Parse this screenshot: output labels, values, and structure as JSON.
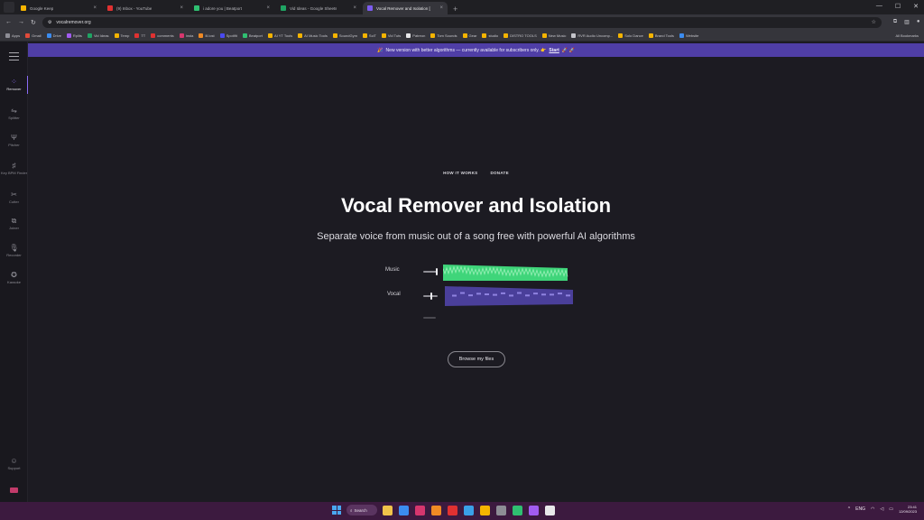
{
  "browser": {
    "tabs": [
      {
        "title": "Google Keep",
        "color": "#f5b400",
        "active": false
      },
      {
        "title": "(9) Inbox - YouTube",
        "color": "#e03131",
        "active": false
      },
      {
        "title": "i adore you | Beatport",
        "color": "#2fbf71",
        "active": false
      },
      {
        "title": "Vid Ideas - Google Sheets",
        "color": "#1fa463",
        "active": false
      },
      {
        "title": "Vocal Remover and Isolation [",
        "color": "#7c5cf0",
        "active": true
      }
    ],
    "new_tab": "+",
    "url": "vocalremover.org",
    "bookmarks": [
      {
        "label": "Apps",
        "color": "#8d8d95"
      },
      {
        "label": "Gmail",
        "color": "#e04a3a"
      },
      {
        "label": "Drive",
        "color": "#3b8cf0"
      },
      {
        "label": "Rplits",
        "color": "#a25cf0"
      },
      {
        "label": "Vid Ideas",
        "color": "#1fa463"
      },
      {
        "label": "Temp",
        "color": "#f5b400"
      },
      {
        "label": "TT",
        "color": "#e03131"
      },
      {
        "label": "comments",
        "color": "#e03131"
      },
      {
        "label": "Insta",
        "color": "#d6366e"
      },
      {
        "label": "Ill.lost",
        "color": "#f08a24"
      },
      {
        "label": "Spotifit",
        "color": "#4a4af0"
      },
      {
        "label": "Beatport",
        "color": "#2fbf71"
      },
      {
        "label": "AI YT Tools",
        "color": "#f5b400"
      },
      {
        "label": "AI Music Tools",
        "color": "#f5b400"
      },
      {
        "label": "SoundGym",
        "color": "#f5b400"
      },
      {
        "label": "SciT",
        "color": "#f5b400"
      },
      {
        "label": "Vid Tuts",
        "color": "#f5b400"
      },
      {
        "label": "Patreon",
        "color": "#e8e8ea"
      },
      {
        "label": "Tom Sounds",
        "color": "#f5b400"
      },
      {
        "label": "Gear",
        "color": "#f5b400"
      },
      {
        "label": "studio",
        "color": "#f5b400"
      },
      {
        "label": "DISTRO TOOLS",
        "color": "#f5b400"
      },
      {
        "label": "New Music",
        "color": "#f5b400"
      },
      {
        "label": "RVR Audio Uncomp...",
        "color": "#c4c4ca"
      },
      {
        "label": "Solo Dance",
        "color": "#f5b400"
      },
      {
        "label": "Brand Tools",
        "color": "#f5b400"
      },
      {
        "label": "Website",
        "color": "#3b8cf0"
      }
    ],
    "all_bookmarks": "All Bookmarks"
  },
  "sidebar": {
    "items": [
      {
        "label": "Remover",
        "icon": "remover-icon",
        "glyph": "⁘",
        "active": true
      },
      {
        "label": "Splitter",
        "icon": "splitter-icon",
        "glyph": "⇋",
        "active": false
      },
      {
        "label": "Pitcher",
        "icon": "tuning-fork-icon",
        "glyph": "Ψ",
        "active": false
      },
      {
        "label": "Key BPM Finder",
        "icon": "key-bpm-icon",
        "glyph": "♯",
        "active": false
      },
      {
        "label": "Cutter",
        "icon": "scissors-icon",
        "glyph": "✂",
        "active": false
      },
      {
        "label": "Joiner",
        "icon": "joiner-icon",
        "glyph": "⧉",
        "active": false
      },
      {
        "label": "Recorder",
        "icon": "microphone-icon",
        "glyph": "🎙",
        "active": false
      },
      {
        "label": "Karaoke",
        "icon": "karaoke-icon",
        "glyph": "✪",
        "active": false
      }
    ],
    "support": {
      "label": "Support",
      "glyph": "☺"
    }
  },
  "banner": {
    "emoji": "🎉",
    "text": "New version with better algorithms — currently available for subscribers only. 👉",
    "link": "Start",
    "trail": "🚀 🚀"
  },
  "page": {
    "nav": [
      "HOW IT WORKS",
      "DONATE"
    ],
    "title": "Vocal Remover and Isolation",
    "subtitle": "Separate voice from music out of a song free with powerful AI algorithms",
    "mixer": {
      "music_label": "Music",
      "vocal_label": "Vocal",
      "music_color": "#3fd57a",
      "vocal_color": "#4a3f9a"
    },
    "browse_button": "Browse my files"
  },
  "taskbar": {
    "search": "Search",
    "apps": [
      "#f0c24a",
      "#3b8cf0",
      "#d6366e",
      "#f08a24",
      "#e03131",
      "#3aa0e8",
      "#f5b400",
      "#8d8d95",
      "#2fbf71",
      "#a25cf0",
      "#e8e8ea"
    ],
    "tray": {
      "lang": "ENG",
      "time": "23:41",
      "date": "12/09/2023"
    }
  }
}
